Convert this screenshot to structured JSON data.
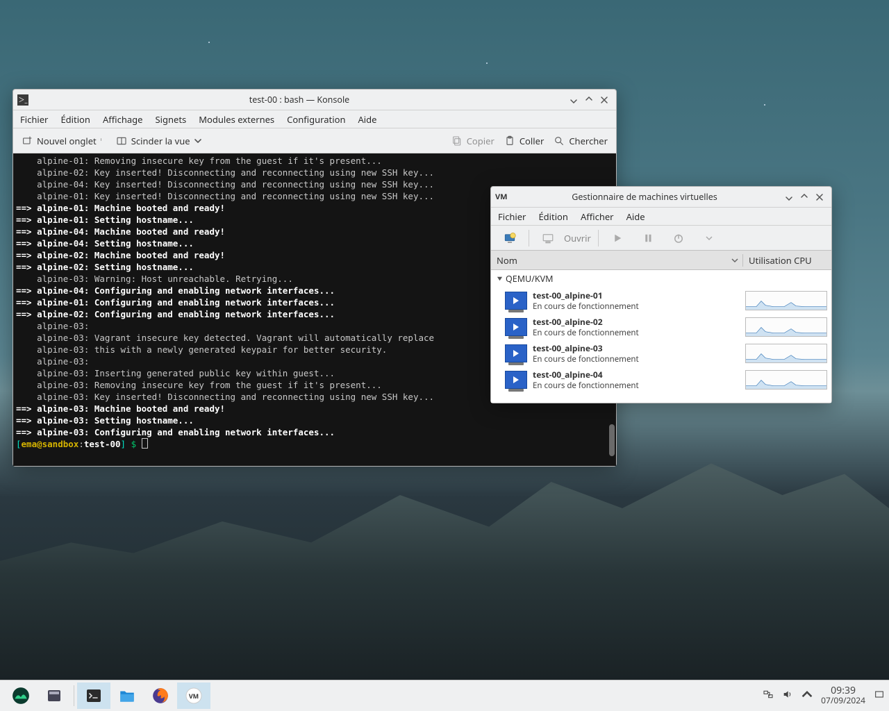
{
  "konsole": {
    "title": "test-00 : bash — Konsole",
    "menu": [
      "Fichier",
      "Édition",
      "Affichage",
      "Signets",
      "Modules externes",
      "Configuration",
      "Aide"
    ],
    "toolbar": {
      "new_tab": "Nouvel onglet",
      "split": "Scinder la vue",
      "copy": "Copier",
      "paste": "Coller",
      "search": "Chercher"
    },
    "lines": [
      {
        "t": "    alpine-01: Removing insecure key from the guest if it's present..."
      },
      {
        "t": "    alpine-02: Key inserted! Disconnecting and reconnecting using new SSH key..."
      },
      {
        "t": "    alpine-04: Key inserted! Disconnecting and reconnecting using new SSH key..."
      },
      {
        "t": "    alpine-01: Key inserted! Disconnecting and reconnecting using new SSH key..."
      },
      {
        "t": "==> alpine-01: Machine booted and ready!",
        "b": true
      },
      {
        "t": "==> alpine-01: Setting hostname...",
        "b": true
      },
      {
        "t": "==> alpine-04: Machine booted and ready!",
        "b": true
      },
      {
        "t": "==> alpine-04: Setting hostname...",
        "b": true
      },
      {
        "t": "==> alpine-02: Machine booted and ready!",
        "b": true
      },
      {
        "t": "==> alpine-02: Setting hostname...",
        "b": true
      },
      {
        "t": "    alpine-03: Warning: Host unreachable. Retrying..."
      },
      {
        "t": "==> alpine-04: Configuring and enabling network interfaces...",
        "b": true
      },
      {
        "t": "==> alpine-01: Configuring and enabling network interfaces...",
        "b": true
      },
      {
        "t": "==> alpine-02: Configuring and enabling network interfaces...",
        "b": true
      },
      {
        "t": "    alpine-03:"
      },
      {
        "t": "    alpine-03: Vagrant insecure key detected. Vagrant will automatically replace"
      },
      {
        "t": "    alpine-03: this with a newly generated keypair for better security."
      },
      {
        "t": "    alpine-03:"
      },
      {
        "t": "    alpine-03: Inserting generated public key within guest..."
      },
      {
        "t": "    alpine-03: Removing insecure key from the guest if it's present..."
      },
      {
        "t": "    alpine-03: Key inserted! Disconnecting and reconnecting using new SSH key..."
      },
      {
        "t": "==> alpine-03: Machine booted and ready!",
        "b": true
      },
      {
        "t": "==> alpine-03: Setting hostname...",
        "b": true
      },
      {
        "t": "==> alpine-03: Configuring and enabling network interfaces...",
        "b": true
      }
    ],
    "prompt": {
      "bracket_l": "[",
      "user": "ema@sandbox",
      "sep": ":",
      "host": "test-00",
      "bracket_r": "] ",
      "dollar": "$"
    }
  },
  "virt": {
    "title": "Gestionnaire de machines virtuelles",
    "menu": [
      "Fichier",
      "Édition",
      "Afficher",
      "Aide"
    ],
    "open_label": "Ouvrir",
    "col_name": "Nom",
    "col_cpu": "Utilisation CPU",
    "group": "QEMU/KVM",
    "status": "En cours de fonctionnement",
    "vms": [
      {
        "name": "test-00_alpine-01"
      },
      {
        "name": "test-00_alpine-02"
      },
      {
        "name": "test-00_alpine-03"
      },
      {
        "name": "test-00_alpine-04"
      }
    ]
  },
  "taskbar": {
    "time": "09:39",
    "date": "07/09/2024"
  }
}
